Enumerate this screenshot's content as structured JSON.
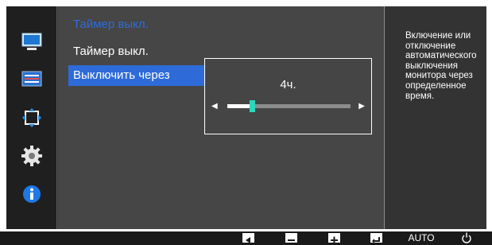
{
  "menu": {
    "title": "Таймер выкл.",
    "items": [
      {
        "label": "Таймер выкл.",
        "active": false
      },
      {
        "label": "Выключить через",
        "active": true
      }
    ]
  },
  "popup": {
    "value_label": "4ч.",
    "slider_fraction": 0.2
  },
  "help": {
    "text": "Включение или отключение автоматического выключения монитора через определенное время."
  },
  "sidebar": {
    "icons": [
      "picture-icon",
      "onscreen-display-icon",
      "position-icon",
      "settings-gear-icon",
      "information-icon"
    ],
    "selected_index": 3
  },
  "bottom_bar": {
    "buttons": [
      "left-arrow-button",
      "minus-button",
      "plus-button",
      "enter-button",
      "AUTO",
      "power-button"
    ],
    "auto_label": "AUTO"
  },
  "colors": {
    "accent_blue": "#2e6bd9",
    "slider_thumb": "#2bd8bd",
    "panel_dark": "#3a3a3a"
  }
}
